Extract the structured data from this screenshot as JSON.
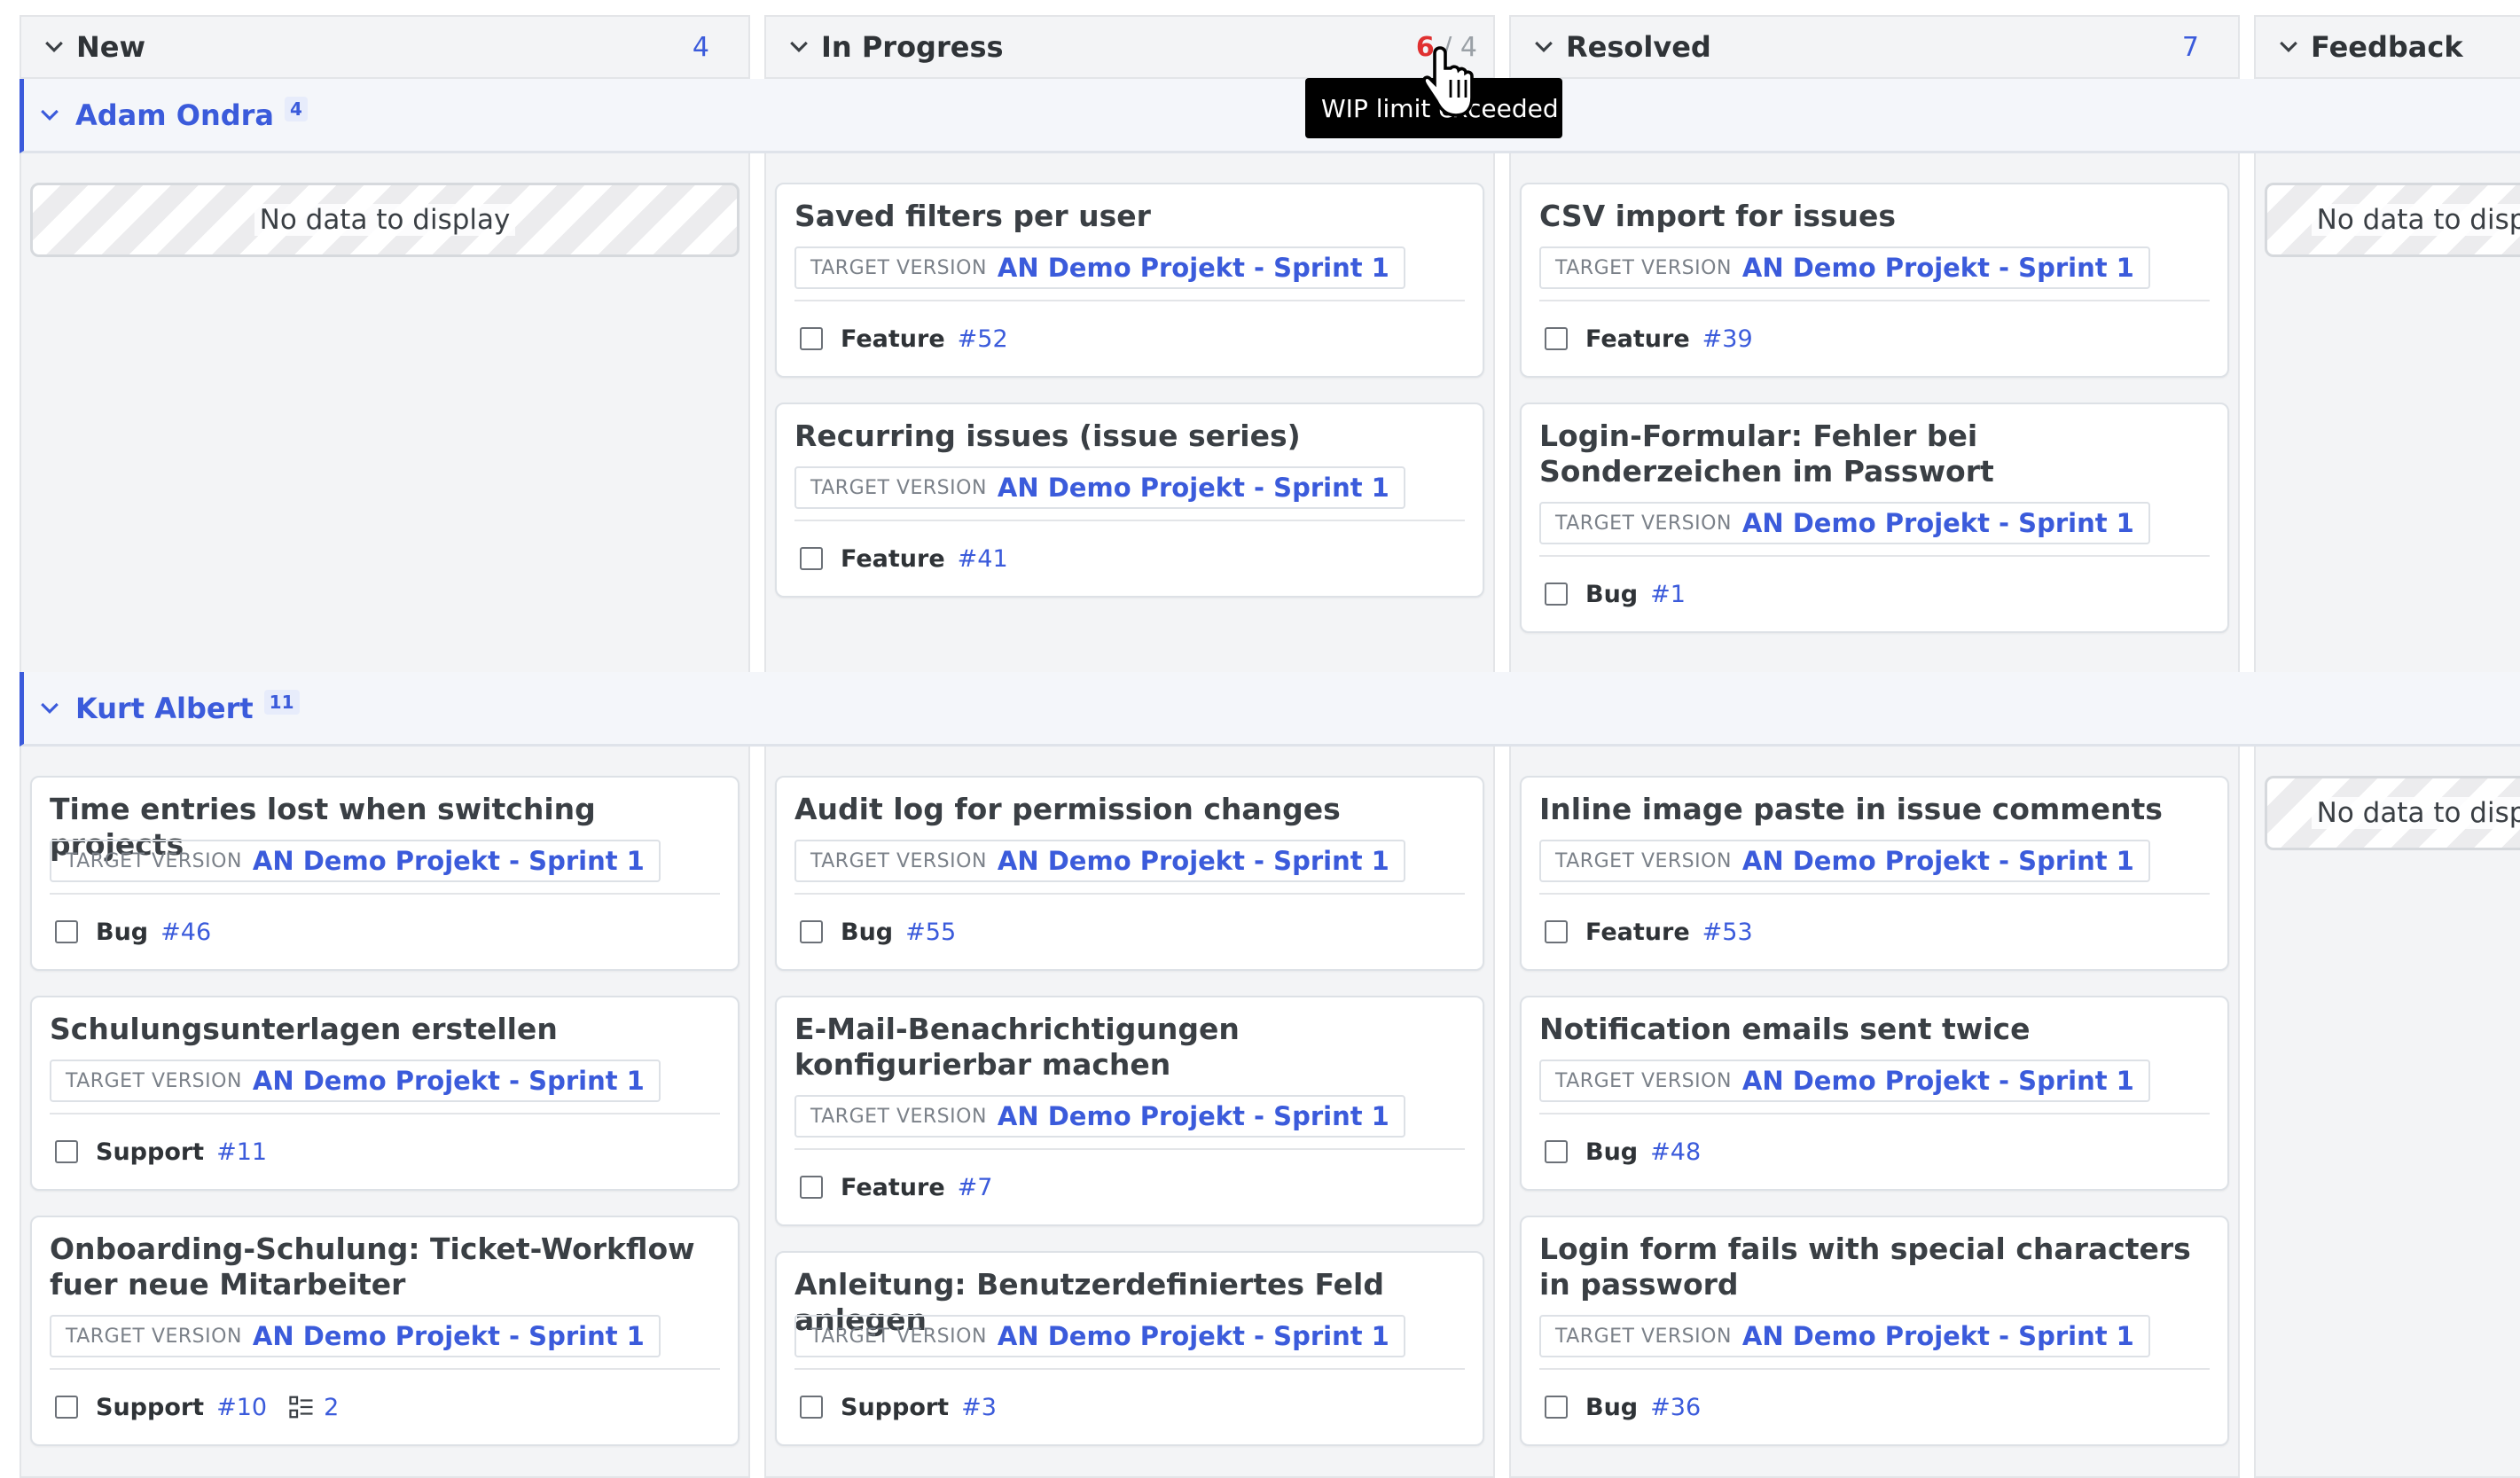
{
  "columns": [
    {
      "name": "New",
      "count": "4"
    },
    {
      "name": "In Progress",
      "wip_current": "6",
      "wip_separator": "/",
      "wip_limit": "4"
    },
    {
      "name": "Resolved",
      "count": "7"
    },
    {
      "name": "Feedback"
    }
  ],
  "tooltip": "WIP limit exceeded",
  "empty_text": "No data to display",
  "target_version_label": "TARGET VERSION",
  "swimlanes": [
    {
      "name": "Adam Ondra",
      "count": "4",
      "cards": {
        "in_progress": [
          {
            "title": "Saved filters per user",
            "version": "AN Demo Projekt - Sprint 1",
            "tracker": "Feature",
            "id": "#52"
          },
          {
            "title": "Recurring issues (issue series)",
            "version": "AN Demo Projekt - Sprint 1",
            "tracker": "Feature",
            "id": "#41"
          }
        ],
        "resolved": [
          {
            "title": "CSV import for issues",
            "version": "AN Demo Projekt - Sprint 1",
            "tracker": "Feature",
            "id": "#39"
          },
          {
            "title": "Login-Formular: Fehler bei Sonderzeichen im Passwort",
            "version": "AN Demo Projekt - Sprint 1",
            "tracker": "Bug",
            "id": "#1"
          }
        ]
      }
    },
    {
      "name": "Kurt Albert",
      "count": "11",
      "cards": {
        "new": [
          {
            "title": "Time entries lost when switching projects",
            "version": "AN Demo Projekt - Sprint 1",
            "tracker": "Bug",
            "id": "#46"
          },
          {
            "title": "Schulungsunterlagen erstellen",
            "version": "AN Demo Projekt - Sprint 1",
            "tracker": "Support",
            "id": "#11"
          },
          {
            "title": "Onboarding-Schulung: Ticket-Workflow fuer neue Mitarbeiter",
            "version": "AN Demo Projekt - Sprint 1",
            "tracker": "Support",
            "id": "#10",
            "subtasks": "2"
          }
        ],
        "in_progress": [
          {
            "title": "Audit log for permission changes",
            "version": "AN Demo Projekt - Sprint 1",
            "tracker": "Bug",
            "id": "#55"
          },
          {
            "title": "E-Mail-Benachrichtigungen konfigurierbar machen",
            "version": "AN Demo Projekt - Sprint 1",
            "tracker": "Feature",
            "id": "#7"
          },
          {
            "title": "Anleitung: Benutzerdefiniertes Feld anlegen",
            "version": "AN Demo Projekt - Sprint 1",
            "tracker": "Support",
            "id": "#3"
          }
        ],
        "resolved": [
          {
            "title": "Inline image paste in issue comments",
            "version": "AN Demo Projekt - Sprint 1",
            "tracker": "Feature",
            "id": "#53"
          },
          {
            "title": "Notification emails sent twice",
            "version": "AN Demo Projekt - Sprint 1",
            "tracker": "Bug",
            "id": "#48"
          },
          {
            "title": "Login form fails with special characters in password",
            "version": "AN Demo Projekt - Sprint 1",
            "tracker": "Bug",
            "id": "#36"
          }
        ]
      }
    }
  ],
  "icons": {
    "chevron": "chevron-down-icon",
    "subtask": "subtask-list-icon",
    "cursor": "hand-pointer-icon"
  },
  "colors": {
    "accent": "#3b5bdb",
    "wip_over": "#e03131"
  }
}
